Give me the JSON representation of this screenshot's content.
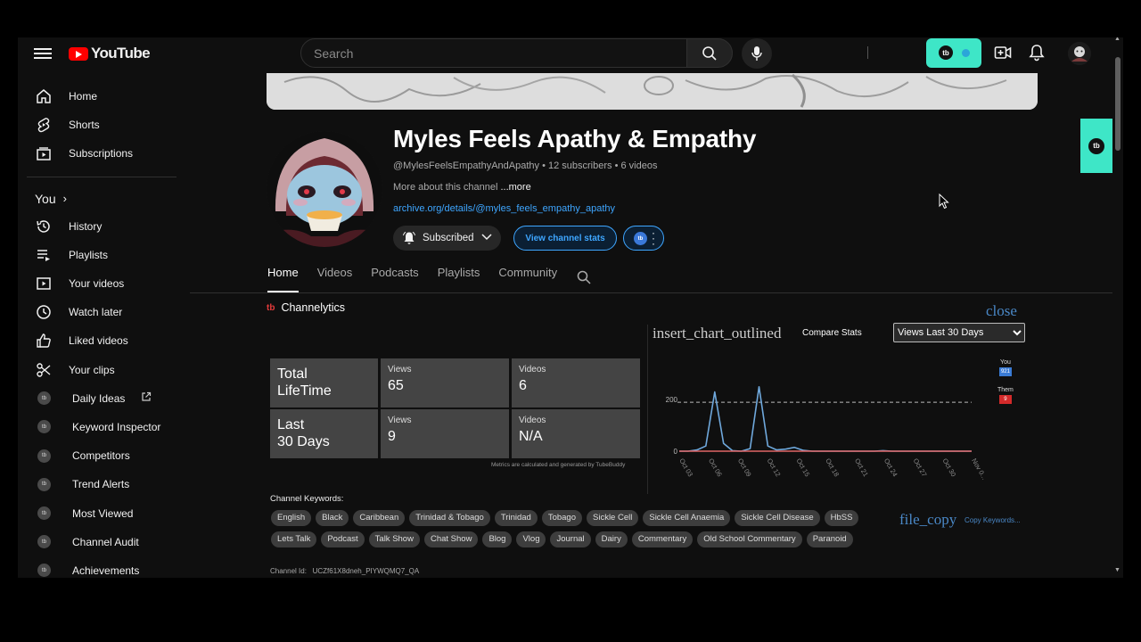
{
  "topbar": {
    "logo_text": "YouTube",
    "search_placeholder": "Search",
    "tubebuddy_badge": "tb"
  },
  "sidebar": {
    "items": [
      {
        "label": "Home",
        "icon": "home-icon"
      },
      {
        "label": "Shorts",
        "icon": "shorts-icon"
      },
      {
        "label": "Subscriptions",
        "icon": "subscriptions-icon"
      }
    ],
    "you_label": "You",
    "you_items": [
      {
        "label": "History",
        "icon": "history-icon"
      },
      {
        "label": "Playlists",
        "icon": "playlists-icon"
      },
      {
        "label": "Your videos",
        "icon": "your-videos-icon"
      },
      {
        "label": "Watch later",
        "icon": "watch-later-icon"
      },
      {
        "label": "Liked videos",
        "icon": "liked-icon"
      },
      {
        "label": "Your clips",
        "icon": "clips-icon"
      }
    ],
    "tubebuddy_items": [
      {
        "label": "Daily Ideas"
      },
      {
        "label": "Keyword Inspector"
      },
      {
        "label": "Competitors"
      },
      {
        "label": "Trend Alerts"
      },
      {
        "label": "Most Viewed"
      },
      {
        "label": "Channel Audit"
      },
      {
        "label": "Achievements"
      }
    ]
  },
  "channel": {
    "title": "Myles Feels Apathy & Empathy",
    "handle_meta": "@MylesFeelsEmpathyAndApathy • 12 subscribers • 6 videos",
    "about": "More about this channel",
    "more": " ...more",
    "link": "archive.org/details/@myles_feels_empathy_apathy",
    "subscribed_label": "Subscribed",
    "stats_button": "View channel stats"
  },
  "tabs": [
    {
      "label": "Home",
      "active": true
    },
    {
      "label": "Videos"
    },
    {
      "label": "Podcasts"
    },
    {
      "label": "Playlists"
    },
    {
      "label": "Community"
    }
  ],
  "channelytics": {
    "badge": "tb",
    "title": "Channelytics",
    "close": "close",
    "chart_icon_name": "insert_chart_outlined",
    "compare_label": "Compare Stats",
    "period_options": [
      "Views Last 30 Days"
    ],
    "stats": {
      "lifetime_label": [
        "Total",
        "LifeTime"
      ],
      "last30_label": [
        "Last",
        "30 Days"
      ],
      "views_label": "Views",
      "videos_label": "Videos",
      "lifetime_views": "65",
      "lifetime_videos": "6",
      "last30_views": "9",
      "last30_videos": "N/A"
    },
    "metrics_note": "Metrics are calculated and generated by TubeBuddy",
    "legend": {
      "you": "You",
      "you_value": "921",
      "them": "Them",
      "them_value": "9"
    },
    "keywords_label": "Channel Keywords:",
    "keywords": [
      "English",
      "Black",
      "Caribbean",
      "Trinidad & Tobago",
      "Trinidad",
      "Tobago",
      "Sickle Cell",
      "Sickle Cell Anaemia",
      "Sickle Cell Disease",
      "HbSS",
      "Lets Talk",
      "Podcast",
      "Talk Show",
      "Chat Show",
      "Blog",
      "Vlog",
      "Journal",
      "Dairy",
      "Commentary",
      "Old School Commentary",
      "Paranoid"
    ],
    "copy_icon_name": "file_copy",
    "copy_label": "Copy Keywords...",
    "channel_id_label": "Channel Id:",
    "channel_id": "UCZf61X8dneh_PIYWQMQ7_QA"
  },
  "chart_data": {
    "type": "line",
    "x": [
      "Oct 03",
      "Oct 06",
      "Oct 09",
      "Oct 12",
      "Oct 15",
      "Oct 18",
      "Oct 21",
      "Oct 24",
      "Oct 27",
      "Oct 30",
      "Nov 0..."
    ],
    "yticks": [
      0,
      200
    ],
    "ylim": [
      0,
      270
    ],
    "average_line": 190,
    "series": [
      {
        "name": "You",
        "color": "#6fa8dc",
        "values": [
          0,
          0,
          5,
          20,
          230,
          30,
          2,
          0,
          10,
          250,
          20,
          5,
          8,
          15,
          3,
          0,
          0,
          0,
          0,
          0,
          0,
          0,
          0,
          2,
          0,
          0,
          0,
          0,
          0,
          0,
          0,
          0,
          0,
          0
        ]
      },
      {
        "name": "Them",
        "color": "#e06666",
        "values": [
          0,
          0,
          0,
          0,
          0,
          0,
          0,
          0,
          0,
          0,
          0,
          0,
          0,
          0,
          0,
          0,
          0,
          0,
          0,
          0,
          0,
          0,
          0,
          0,
          0,
          0,
          0,
          0,
          0,
          0,
          0,
          0,
          0,
          0
        ]
      }
    ]
  }
}
